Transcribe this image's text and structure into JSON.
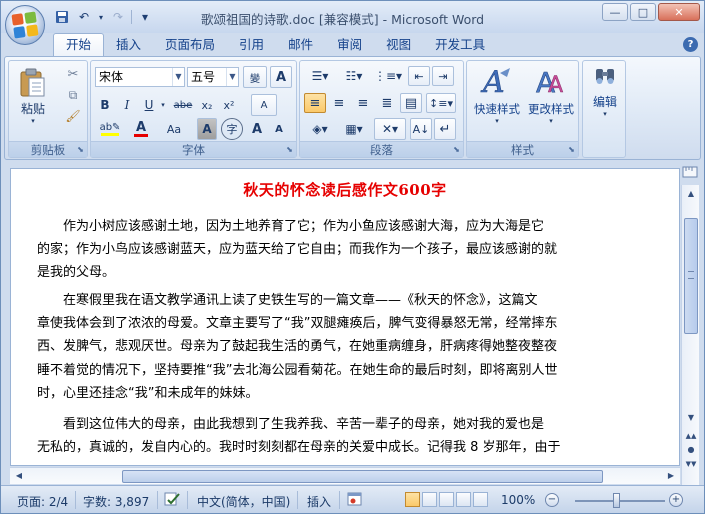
{
  "window": {
    "title": "歌颂祖国的诗歌.doc [兼容模式] - Microsoft Word",
    "controls": {
      "minimize": "—",
      "maximize": "□",
      "close": "✕"
    }
  },
  "qat": {
    "save_icon": "save-icon",
    "undo": "↶",
    "redo": "↷",
    "customize": "▾"
  },
  "tabs": [
    "开始",
    "插入",
    "页面布局",
    "引用",
    "邮件",
    "审阅",
    "视图",
    "开发工具"
  ],
  "ribbon": {
    "clipboard": {
      "label": "剪贴板",
      "paste": "粘贴"
    },
    "font": {
      "label": "字体",
      "font_name": "宋体",
      "font_size": "五号",
      "buttons": {
        "bold": "B",
        "italic": "I",
        "underline": "U",
        "strike": "abe",
        "subscript": "x₂",
        "superscript": "x²",
        "grow": "A",
        "shrink": "A",
        "change_case": "Aa",
        "char_border": "A",
        "char_circle": "字",
        "phonetic": "變",
        "clear": "A"
      }
    },
    "paragraph": {
      "label": "段落"
    },
    "styles": {
      "label": "样式",
      "quick_styles": "快速样式",
      "change_styles": "更改样式"
    },
    "editing": {
      "label": "编辑",
      "edit": "编辑"
    }
  },
  "document": {
    "title": "秋天的怀念读后感作文600字",
    "paragraphs": [
      [
        "　　作为小树应该感谢土地，因为土地养育了它；作为小鱼应该感谢大海，应为大海是它",
        "的家；作为小鸟应该感谢蓝天，应为蓝天给了它自由；而我作为一个孩子，最应该感谢的就",
        "是我的父母。"
      ],
      [
        "　　在寒假里我在语文教学通讯上读了史铁生写的一篇文章——《秋天的怀念》，这篇文",
        "章使我体会到了浓浓的母爱。文章主要写了“我”双腿瘫痪后，脾气变得暴怒无常，经常摔东",
        "西、发脾气，悲观厌世。母亲为了鼓起我生活的勇气，在她重病缠身，肝病疼得她整夜整夜",
        "睡不着觉的情况下，坚持要推“我”去北海公园看菊花。在她生命的最后时刻，即将离别人世",
        "时，心里还挂念“我”和未成年的妹妹。"
      ],
      [
        "　　看到这位伟大的母亲，由此我想到了生我养我、辛苦一辈子的母亲，她对我的爱也是",
        "无私的，真诚的，发自内心的。我时时刻刻都在母亲的关爱中成长。记得我 8 岁那年，由于"
      ]
    ]
  },
  "statusbar": {
    "page": "页面: 2/4",
    "words": "字数: 3,897",
    "language": "中文(简体，中国)",
    "insert_mode": "插入",
    "zoom": "100%",
    "zoom_level": 1.0
  }
}
